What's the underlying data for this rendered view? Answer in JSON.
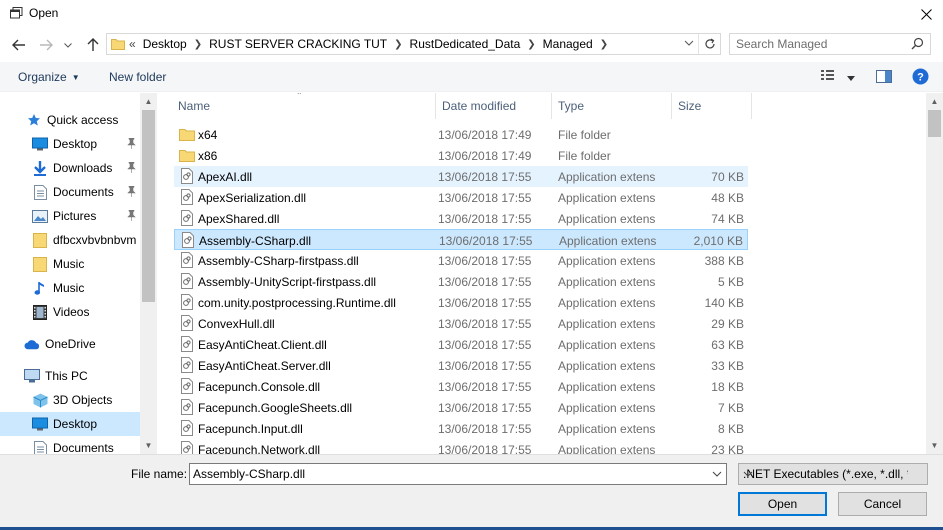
{
  "window": {
    "title": "Open"
  },
  "address": {
    "overflow": "«",
    "crumbs": [
      "Desktop",
      "RUST SERVER CRACKING TUT",
      "RustDedicated_Data",
      "Managed"
    ]
  },
  "search": {
    "placeholder": "Search Managed"
  },
  "toolbar": {
    "organize": "Organize",
    "new_folder": "New folder"
  },
  "nav": {
    "items": [
      {
        "label": "Quick access",
        "icon": "star-icon"
      },
      {
        "label": "Desktop",
        "icon": "desktop-icon",
        "pinned": true
      },
      {
        "label": "Downloads",
        "icon": "download-icon",
        "pinned": true
      },
      {
        "label": "Documents",
        "icon": "document-icon",
        "pinned": true
      },
      {
        "label": "Pictures",
        "icon": "pictures-icon",
        "pinned": true
      },
      {
        "label": "dfbcxvbvbnbvm",
        "icon": "folder-icon"
      },
      {
        "label": "Music",
        "icon": "folder-icon"
      },
      {
        "label": "Music",
        "icon": "music-icon"
      },
      {
        "label": "Videos",
        "icon": "video-icon"
      },
      {
        "label": "OneDrive",
        "icon": "cloud-icon"
      },
      {
        "label": "This PC",
        "icon": "computer-icon"
      },
      {
        "label": "3D Objects",
        "icon": "cube-icon"
      },
      {
        "label": "Desktop",
        "icon": "desktop-icon"
      },
      {
        "label": "Documents",
        "icon": "document-icon"
      }
    ]
  },
  "columns": {
    "name": "Name",
    "date": "Date modified",
    "type": "Type",
    "size": "Size"
  },
  "files": [
    {
      "name": "x64",
      "date": "13/06/2018 17:49",
      "type": "File folder",
      "size": "",
      "kind": "folder"
    },
    {
      "name": "x86",
      "date": "13/06/2018 17:49",
      "type": "File folder",
      "size": "",
      "kind": "folder"
    },
    {
      "name": "ApexAI.dll",
      "date": "13/06/2018 17:55",
      "type": "Application extens",
      "size": "70 KB",
      "kind": "dll"
    },
    {
      "name": "ApexSerialization.dll",
      "date": "13/06/2018 17:55",
      "type": "Application extens",
      "size": "48 KB",
      "kind": "dll"
    },
    {
      "name": "ApexShared.dll",
      "date": "13/06/2018 17:55",
      "type": "Application extens",
      "size": "74 KB",
      "kind": "dll"
    },
    {
      "name": "Assembly-CSharp.dll",
      "date": "13/06/2018 17:55",
      "type": "Application extens",
      "size": "2,010 KB",
      "kind": "dll"
    },
    {
      "name": "Assembly-CSharp-firstpass.dll",
      "date": "13/06/2018 17:55",
      "type": "Application extens",
      "size": "388 KB",
      "kind": "dll"
    },
    {
      "name": "Assembly-UnityScript-firstpass.dll",
      "date": "13/06/2018 17:55",
      "type": "Application extens",
      "size": "5 KB",
      "kind": "dll"
    },
    {
      "name": "com.unity.postprocessing.Runtime.dll",
      "date": "13/06/2018 17:55",
      "type": "Application extens",
      "size": "140 KB",
      "kind": "dll"
    },
    {
      "name": "ConvexHull.dll",
      "date": "13/06/2018 17:55",
      "type": "Application extens",
      "size": "29 KB",
      "kind": "dll"
    },
    {
      "name": "EasyAntiCheat.Client.dll",
      "date": "13/06/2018 17:55",
      "type": "Application extens",
      "size": "63 KB",
      "kind": "dll"
    },
    {
      "name": "EasyAntiCheat.Server.dll",
      "date": "13/06/2018 17:55",
      "type": "Application extens",
      "size": "33 KB",
      "kind": "dll"
    },
    {
      "name": "Facepunch.Console.dll",
      "date": "13/06/2018 17:55",
      "type": "Application extens",
      "size": "18 KB",
      "kind": "dll"
    },
    {
      "name": "Facepunch.GoogleSheets.dll",
      "date": "13/06/2018 17:55",
      "type": "Application extens",
      "size": "7 KB",
      "kind": "dll"
    },
    {
      "name": "Facepunch.Input.dll",
      "date": "13/06/2018 17:55",
      "type": "Application extens",
      "size": "8 KB",
      "kind": "dll"
    },
    {
      "name": "Facepunch.Network.dll",
      "date": "13/06/2018 17:55",
      "type": "Application extens",
      "size": "23 KB",
      "kind": "dll"
    }
  ],
  "footer": {
    "file_name_label": "File name:",
    "file_name_value": "Assembly-CSharp.dll",
    "file_type": ".NET Executables (*.exe, *.dll, *.i",
    "open_label": "Open",
    "cancel_label": "Cancel"
  },
  "colors": {
    "selection": "#cce8ff",
    "hover": "#e5f3ff",
    "accent": "#0078d7",
    "folder": "#f8d775"
  }
}
